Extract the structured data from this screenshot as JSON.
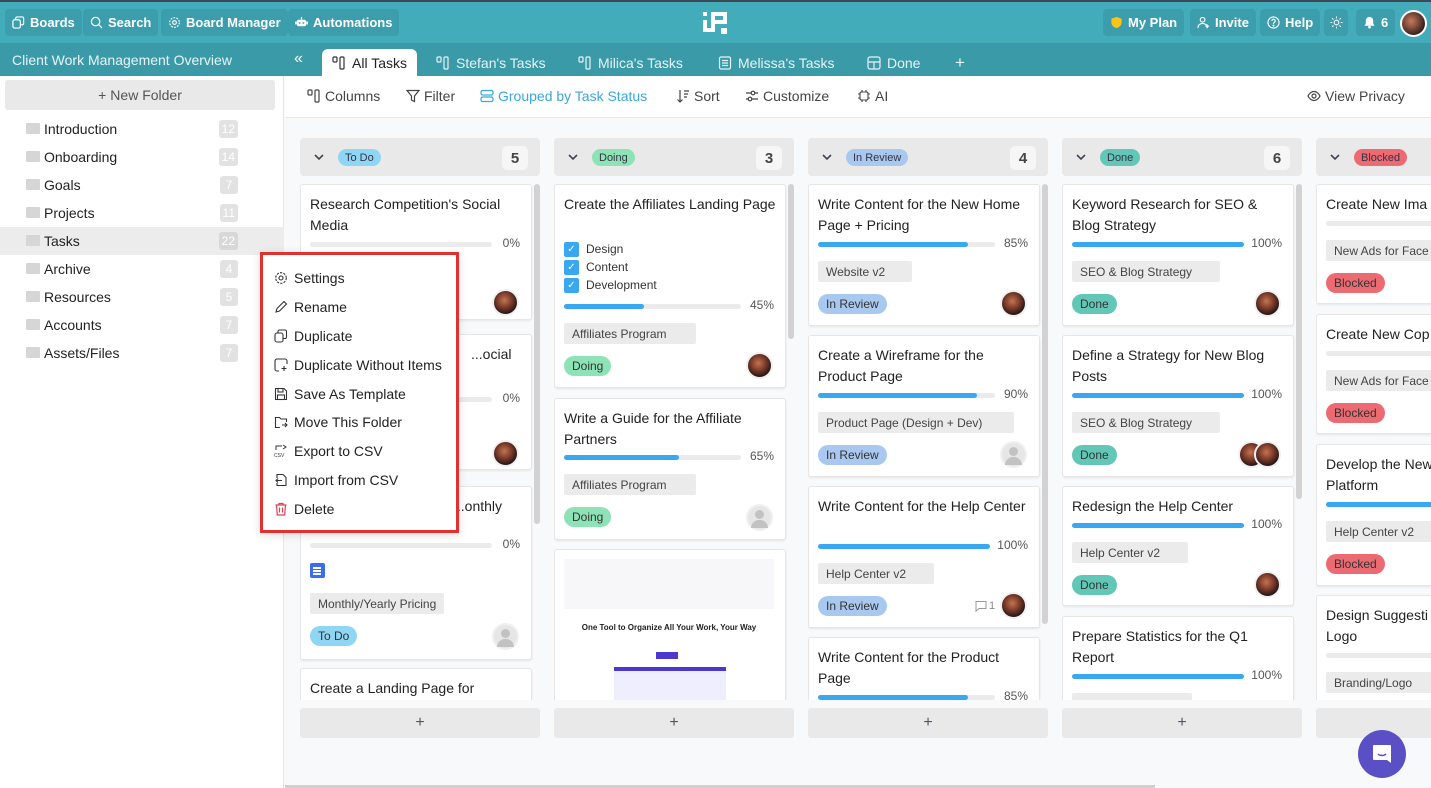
{
  "topbar": {
    "boards": "Boards",
    "search": "Search",
    "board_manager": "Board Manager",
    "automations": "Automations",
    "my_plan": "My Plan",
    "invite": "Invite",
    "help": "Help",
    "notifications_count": "6"
  },
  "board": {
    "title": "Client Work Management Overview",
    "tabs": [
      {
        "label": "All Tasks",
        "icon": "columns-icon",
        "active": true
      },
      {
        "label": "Stefan's Tasks",
        "icon": "columns-icon"
      },
      {
        "label": "Milica's Tasks",
        "icon": "columns-icon"
      },
      {
        "label": "Melissa's Tasks",
        "icon": "list-icon"
      },
      {
        "label": "Done",
        "icon": "table-icon"
      }
    ],
    "add_tab": "+"
  },
  "toolbar": {
    "columns": "Columns",
    "filter": "Filter",
    "grouped": "Grouped by Task Status",
    "sort": "Sort",
    "customize": "Customize",
    "ai": "AI",
    "view_privacy": "View Privacy"
  },
  "sidebar": {
    "new_folder": "New Folder",
    "folders": [
      {
        "label": "Introduction",
        "count": "12"
      },
      {
        "label": "Onboarding",
        "count": "14"
      },
      {
        "label": "Goals",
        "count": "7"
      },
      {
        "label": "Projects",
        "count": "11"
      },
      {
        "label": "Tasks",
        "count": "22",
        "active": true
      },
      {
        "label": "Archive",
        "count": "4"
      },
      {
        "label": "Resources",
        "count": "5"
      },
      {
        "label": "Accounts",
        "count": "7"
      },
      {
        "label": "Assets/Files",
        "count": "7"
      }
    ]
  },
  "context_menu": {
    "items": [
      {
        "label": "Settings",
        "icon": "gear-icon"
      },
      {
        "label": "Rename",
        "icon": "pencil-icon"
      },
      {
        "label": "Duplicate",
        "icon": "duplicate-icon"
      },
      {
        "label": "Duplicate Without Items",
        "icon": "duplicate-plus-icon"
      },
      {
        "label": "Save As Template",
        "icon": "save-icon"
      },
      {
        "label": "Move This Folder",
        "icon": "move-folder-icon"
      },
      {
        "label": "Export to CSV",
        "icon": "export-csv-icon"
      },
      {
        "label": "Import from CSV",
        "icon": "import-csv-icon"
      },
      {
        "label": "Delete",
        "icon": "trash-icon",
        "danger": true
      }
    ]
  },
  "colors": {
    "todo": "#8fd6f5",
    "doing": "#8de3b6",
    "in_review": "#a9c8f0",
    "done": "#62c7b7",
    "blocked": "#ec6a72",
    "progress": "#3aa8f0",
    "topbar": "#42acbb"
  },
  "columns": [
    {
      "status": "To Do",
      "count": "5",
      "cards": [
        {
          "title": "Research Competition's Social Media",
          "progress": "0%"
        },
        {
          "title": "...ocial",
          "progress": "0%"
        },
        {
          "title": "...onthly",
          "progress": "0%",
          "tag": "Monthly/Yearly Pricing",
          "status": "To Do"
        },
        {
          "title": "Create a Landing Page for"
        }
      ]
    },
    {
      "status": "Doing",
      "count": "3",
      "cards": [
        {
          "title": "Create the Affiliates Landing Page",
          "checklist": [
            "Design",
            "Content",
            "Development"
          ],
          "progress": "45%",
          "tag": "Affiliates Program",
          "status": "Doing"
        },
        {
          "title": "Write a Guide for the Affiliate Partners",
          "progress": "65%",
          "tag": "Affiliates Program",
          "status": "Doing"
        },
        {
          "preview_headline": "One Tool to Organize All Your Work, Your Way"
        }
      ]
    },
    {
      "status": "In Review",
      "count": "4",
      "cards": [
        {
          "title": "Write Content for the New Home Page + Pricing",
          "progress": "85%",
          "tag": "Website v2",
          "status": "In Review"
        },
        {
          "title": "Create a Wireframe for the Product Page",
          "progress": "90%",
          "tag": "Product Page (Design + Dev)",
          "status": "In Review"
        },
        {
          "title": "Write Content for the Help Center",
          "progress": "100%",
          "tag": "Help Center v2",
          "status": "In Review",
          "comments": "1"
        },
        {
          "title": "Write Content for the Product Page",
          "progress": "85%"
        }
      ]
    },
    {
      "status": "Done",
      "count": "6",
      "cards": [
        {
          "title": "Keyword Research for SEO & Blog Strategy",
          "progress": "100%",
          "tag": "SEO & Blog Strategy",
          "status": "Done"
        },
        {
          "title": "Define a Strategy for New Blog Posts",
          "progress": "100%",
          "tag": "SEO & Blog Strategy",
          "status": "Done"
        },
        {
          "title": "Redesign the Help Center",
          "progress": "100%",
          "tag": "Help Center v2",
          "status": "Done"
        },
        {
          "title": "Prepare Statistics for the Q1 Report",
          "progress": "100%"
        }
      ]
    },
    {
      "status": "Blocked",
      "cards": [
        {
          "title": "Create New Ima",
          "tag": "New Ads for Face",
          "status": "Blocked"
        },
        {
          "title": "Create New Cop",
          "tag": "New Ads for Face",
          "status": "Blocked"
        },
        {
          "title": "Develop the New Platform",
          "tag": "Help Center v2",
          "status": "Blocked"
        },
        {
          "title": "Design Suggesti Logo",
          "tag": "Branding/Logo"
        }
      ]
    }
  ],
  "add_card": "+"
}
